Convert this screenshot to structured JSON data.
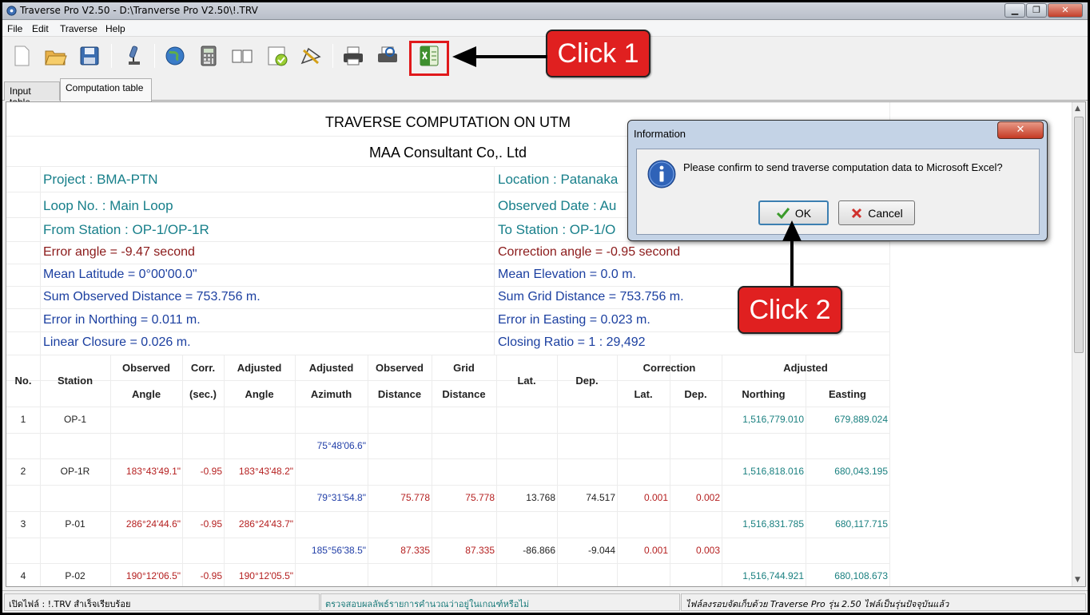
{
  "window": {
    "title": "Traverse Pro V2.50 - D:\\Tranverse Pro V2.50\\!.TRV",
    "minimize": "▁",
    "maximize": "❐",
    "close": "✕"
  },
  "menu": [
    "File",
    "Edit",
    "Traverse",
    "Help"
  ],
  "toolbar": {
    "icons": [
      "new-file-icon",
      "open-folder-icon",
      "save-disk-icon",
      "microscope-icon",
      "globe-icon",
      "calculator-icon",
      "book-icon",
      "checklist-icon",
      "survey-drawing-icon",
      "printer-icon",
      "print-preview-icon",
      "excel-export-icon"
    ]
  },
  "callouts": {
    "click1": "Click 1",
    "click2": "Click 2"
  },
  "tabs": [
    "Input table",
    "Computation table"
  ],
  "report": {
    "title": "TRAVERSE COMPUTATION ON UTM",
    "company": "MAA Consultant Co,. Ltd",
    "project": "Project : BMA-PTN",
    "location": "Location : Patanaka",
    "loop": "Loop No. : Main Loop",
    "observed_date": "Observed Date : Au",
    "from_station": "From Station : OP-1/OP-1R",
    "to_station": "To Station : OP-1/O",
    "error_angle": "Error angle = -9.47 second",
    "correction_angle": "Correction angle = -0.95 second",
    "mean_latitude": "Mean Latitude = 0°00'00.0\"",
    "mean_elevation": "Mean Elevation =  0.0 m.",
    "sum_observed": "Sum Observed Distance =  753.756 m.",
    "sum_grid": "Sum Grid Distance =  753.756 m.",
    "error_northing": "Error in Northing = 0.011 m.",
    "error_easting": "Error in Easting = 0.023 m.",
    "linear_closure": "Linear Closure = 0.026 m.",
    "closing_ratio": "Closing Ratio = 1 :  29,492"
  },
  "table": {
    "headers": {
      "no": "No.",
      "station": "Station",
      "observed": "Observed",
      "angle": "Angle",
      "corr": "Corr.",
      "sec": "(sec.)",
      "adjusted": "Adjusted",
      "adj_angle": "Angle",
      "adjusted2": "Adjusted",
      "azimuth": "Azimuth",
      "observed2": "Observed",
      "distance": "Distance",
      "grid": "Grid",
      "grid_distance": "Distance",
      "lat": "Lat.",
      "dep": "Dep.",
      "correction": "Correction",
      "corr_lat": "Lat.",
      "corr_dep": "Dep.",
      "adjusted3": "Adjusted",
      "northing": "Northing",
      "easting": "Easting"
    },
    "stations": [
      {
        "no": "1",
        "station": "OP-1",
        "obs_angle": "",
        "corr": "",
        "adj_angle": "",
        "northing": "1,516,779.010",
        "easting": "679,889.024"
      },
      {
        "no": "2",
        "station": "OP-1R",
        "obs_angle": "183°43'49.1\"",
        "corr": "-0.95",
        "adj_angle": "183°43'48.2\"",
        "northing": "1,516,818.016",
        "easting": "680,043.195"
      },
      {
        "no": "3",
        "station": "P-01",
        "obs_angle": "286°24'44.6\"",
        "corr": "-0.95",
        "adj_angle": "286°24'43.7\"",
        "northing": "1,516,831.785",
        "easting": "680,117.715"
      },
      {
        "no": "4",
        "station": "P-02",
        "obs_angle": "190°12'06.5\"",
        "corr": "-0.95",
        "adj_angle": "190°12'05.5\"",
        "northing": "1,516,744.921",
        "easting": "680,108.673"
      }
    ],
    "legs": [
      {
        "azimuth": "75°48'06.6\"",
        "obs_dist": "",
        "grid_dist": "",
        "lat": "",
        "dep": "",
        "clat": "",
        "cdep": ""
      },
      {
        "azimuth": "79°31'54.8\"",
        "obs_dist": "75.778",
        "grid_dist": "75.778",
        "lat": "13.768",
        "dep": "74.517",
        "clat": "0.001",
        "cdep": "0.002"
      },
      {
        "azimuth": "185°56'38.5\"",
        "obs_dist": "87.335",
        "grid_dist": "87.335",
        "lat": "-86.866",
        "dep": "-9.044",
        "clat": "0.001",
        "cdep": "0.003"
      }
    ]
  },
  "dialog": {
    "title": "Information",
    "close": "✕",
    "message": "Please confirm to send traverse computation data to Microsoft Excel?",
    "ok": "OK",
    "cancel": "Cancel"
  },
  "status": {
    "left": "เปิดไฟล์ : !.TRV  สำเร็จเรียบร้อย",
    "middle": "ตรวจสอบผลลัพธ์รายการคำนวณว่าอยู่ในเกณฑ์หรือไม่",
    "right": "ไฟล์ลงรอบจัดเก็บด้วย Traverse Pro รุ่น 2.50 ไฟล์เป็นรุ่นปัจจุบันแล้ว"
  },
  "colors": {
    "callout": "#e02020",
    "teal": "#177f8a",
    "blue": "#1b3fa0",
    "maroon": "#8b1a1a",
    "red_values": "#b52020"
  }
}
